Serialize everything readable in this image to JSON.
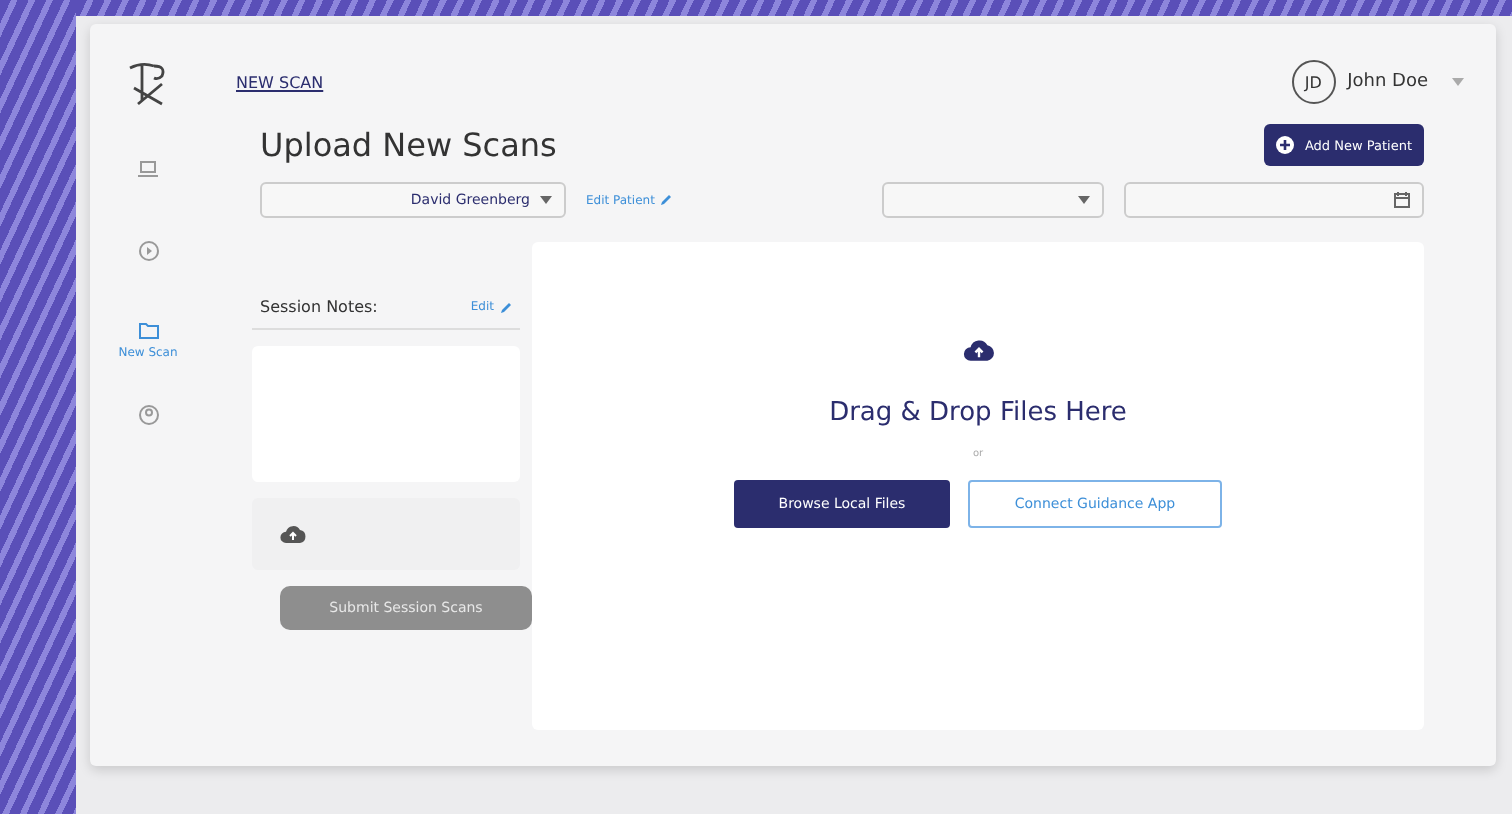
{
  "breadcrumb": "NEW SCAN",
  "user": {
    "initials": "JD",
    "name": "John Doe"
  },
  "nav": [
    {
      "selected": false
    },
    {
      "selected": false
    },
    {
      "label": "New Scan",
      "selected": true
    },
    {
      "selected": false
    }
  ],
  "title": "Upload New Scans",
  "add_button": "Add New Patient",
  "patient_select": {
    "value": "David Greenberg"
  },
  "edit_patient": "Edit Patient",
  "session_notes": {
    "label": "Session Notes:",
    "edit": "Edit"
  },
  "submit_button": {
    "label": "Submit Session Scans",
    "disabled": true
  },
  "dropzone": {
    "heading": "Drag & Drop Files Here",
    "or": "or",
    "browse": "Browse Local Files",
    "connect": "Connect Guidance App"
  }
}
